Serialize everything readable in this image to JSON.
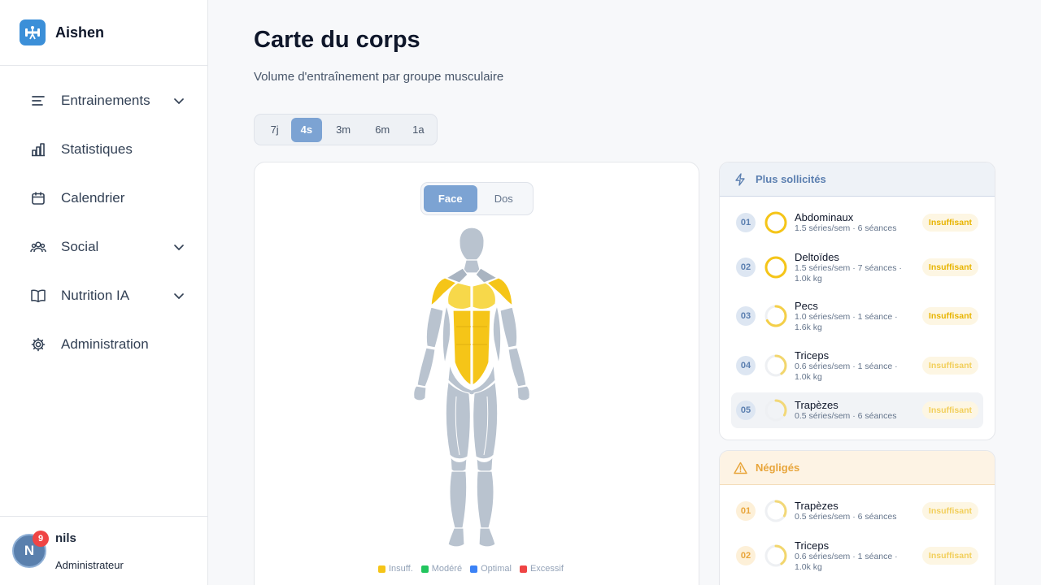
{
  "app": {
    "name": "Aishen"
  },
  "nav": [
    {
      "label": "Entrainements",
      "icon": "list-icon",
      "expandable": true
    },
    {
      "label": "Statistiques",
      "icon": "bar-chart-icon",
      "expandable": false
    },
    {
      "label": "Calendrier",
      "icon": "calendar-icon",
      "expandable": false
    },
    {
      "label": "Social",
      "icon": "users-icon",
      "expandable": true
    },
    {
      "label": "Nutrition IA",
      "icon": "book-icon",
      "expandable": true
    },
    {
      "label": "Administration",
      "icon": "gear-icon",
      "expandable": false
    }
  ],
  "user": {
    "initial": "N",
    "notifications": "9",
    "name": "nils",
    "role": "Administrateur"
  },
  "page": {
    "title": "Carte du corps",
    "subtitle": "Volume d'entraînement par groupe musculaire"
  },
  "periods": {
    "options": [
      "7j",
      "4s",
      "3m",
      "6m",
      "1a"
    ],
    "selected": "4s"
  },
  "body_view": {
    "options": [
      "Face",
      "Dos"
    ],
    "selected": "Face"
  },
  "legend": [
    {
      "label": "Insuff.",
      "color": "#f5c518"
    },
    {
      "label": "Modéré",
      "color": "#22c55e"
    },
    {
      "label": "Optimal",
      "color": "#3b82f6"
    },
    {
      "label": "Excessif",
      "color": "#ef4444"
    }
  ],
  "most_worked": {
    "title": "Plus sollicités",
    "items": [
      {
        "rank": "01",
        "name": "Abdominaux",
        "stats": "1.5 séries/sem · 6 séances",
        "status": "Insuffisant",
        "level": 1.0
      },
      {
        "rank": "02",
        "name": "Deltoïdes",
        "stats": "1.5 séries/sem · 7 séances · 1.0k kg",
        "status": "Insuffisant",
        "level": 1.0
      },
      {
        "rank": "03",
        "name": "Pecs",
        "stats": "1.0 séries/sem · 1 séance · 1.6k kg",
        "status": "Insuffisant",
        "level": 0.67
      },
      {
        "rank": "04",
        "name": "Triceps",
        "stats": "0.6 séries/sem · 1 séance · 1.0k kg",
        "status": "Insuffisant",
        "level": 0.4
      },
      {
        "rank": "05",
        "name": "Trapèzes",
        "stats": "0.5 séries/sem · 6 séances",
        "status": "Insuffisant",
        "level": 0.33
      }
    ]
  },
  "neglected": {
    "title": "Négligés",
    "items": [
      {
        "rank": "01",
        "name": "Trapèzes",
        "stats": "0.5 séries/sem · 6 séances",
        "status": "Insuffisant",
        "level": 0.33
      },
      {
        "rank": "02",
        "name": "Triceps",
        "stats": "0.6 séries/sem · 1 séance · 1.0k kg",
        "status": "Insuffisant",
        "level": 0.4
      }
    ]
  },
  "colors": {
    "accent": "#7ca3d3",
    "insufficient": "#f5c518",
    "muscle_base": "#b9c3cf"
  }
}
